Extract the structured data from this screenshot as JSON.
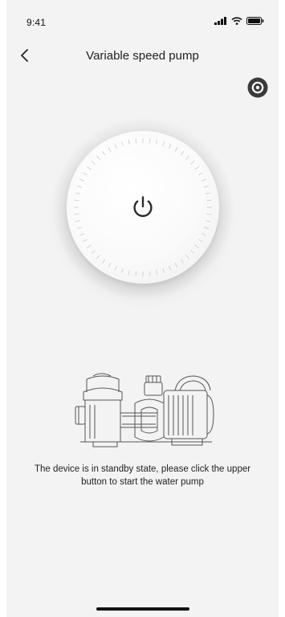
{
  "status_bar": {
    "time": "9:41"
  },
  "header": {
    "title": "Variable speed pump"
  },
  "icons": {
    "back": "chevron-left-icon",
    "settings": "settings-icon",
    "power": "power-icon",
    "signal": "signal-icon",
    "wifi": "wifi-icon",
    "battery": "battery-icon"
  },
  "device": {
    "state_message": "The device is in standby state, please click the upper button to start the water pump"
  },
  "colors": {
    "background": "#f3f3f3",
    "icon_dark": "#3a3a3a",
    "text": "#222222"
  }
}
